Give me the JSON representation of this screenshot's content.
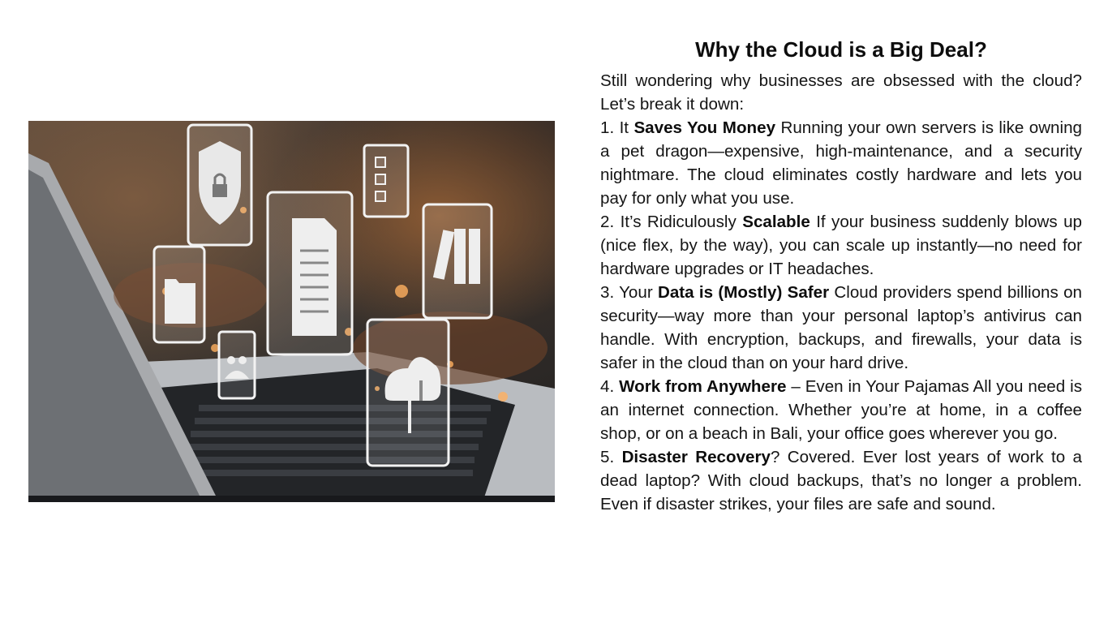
{
  "article": {
    "title": "Why the Cloud is a Big Deal?",
    "intro": "Still wondering why businesses are obsessed with the cloud? Let’s break it down:",
    "points": [
      {
        "prefix": "1. It ",
        "bold": "Saves You Money",
        "text": " Running your own servers is like owning a pet dragon—expensive, high-maintenance, and a security nightmare. The cloud eliminates costly hardware and lets you pay for only what you use."
      },
      {
        "prefix": "2. It’s Ridiculously ",
        "bold": "Scalable",
        "text": " If your business suddenly blows up (nice flex, by the way), you can scale up instantly—no need for hardware upgrades or IT headaches."
      },
      {
        "prefix": "3. Your ",
        "bold": "Data is (Mostly) Safer",
        "text": " Cloud providers spend billions on security—way more than your personal laptop’s antivirus can handle. With encryption, backups, and firewalls, your data is safer in the cloud than on your hard drive."
      },
      {
        "prefix": "4. ",
        "bold": "Work from Anywhere",
        "text": " – Even in Your Pajamas All you need is an internet connection. Whether you’re at home, in a coffee shop, or on a beach in Bali, your office goes wherever you go."
      },
      {
        "prefix": "5. ",
        "bold": "Disaster Recovery",
        "text": "? Covered. Ever lost years of work to a dead laptop? With cloud backups, that’s no longer a problem. Even if disaster strikes, your files are safe and sound."
      }
    ]
  },
  "image": {
    "icons": [
      "security-shield-lock-icon",
      "checklist-icon",
      "document-icon",
      "binders-icon",
      "folder-icon",
      "users-group-icon",
      "cloud-transfer-icon"
    ]
  }
}
